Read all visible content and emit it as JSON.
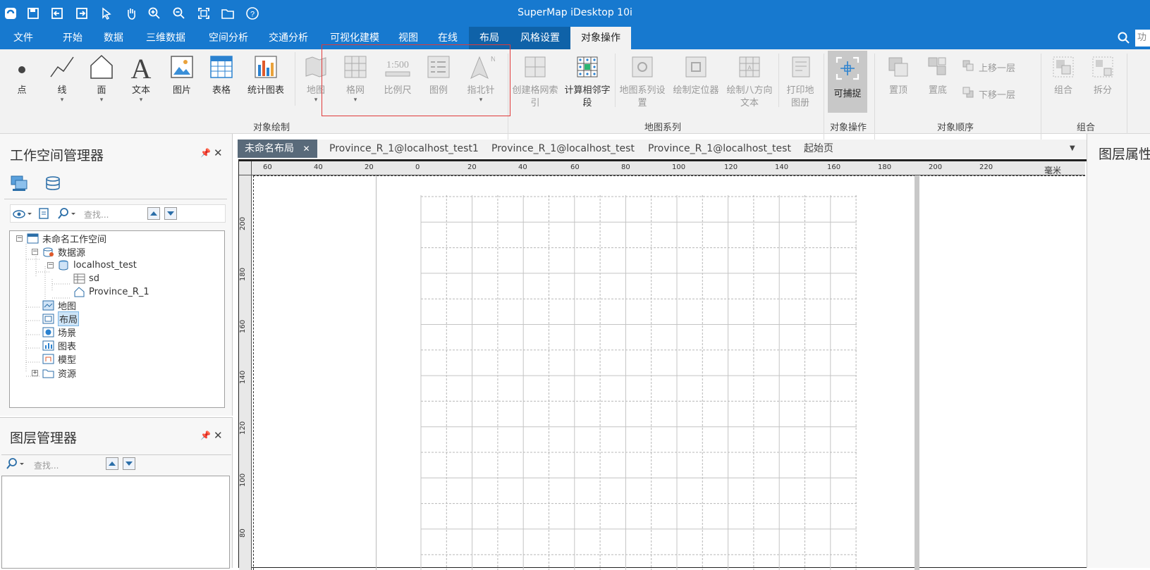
{
  "app": {
    "title": "SuperMap iDesktop 10i"
  },
  "menu": {
    "tabs": [
      "文件",
      "开始",
      "数据",
      "三维数据",
      "空间分析",
      "交通分析",
      "可视化建模",
      "视图",
      "在线",
      "布局",
      "风格设置",
      "对象操作"
    ],
    "search_placeholder": "功"
  },
  "ribbon": {
    "draw_group": {
      "label": "对象绘制",
      "buttons": [
        "点",
        "线",
        "面",
        "文本",
        "图片",
        "表格",
        "统计图表",
        "地图",
        "格网",
        "比例尺",
        "图例",
        "指北针"
      ]
    },
    "series_group": {
      "label": "地图系列",
      "buttons": [
        "创建格网索引",
        "计算相邻字段",
        "地图系列设置",
        "绘制定位器",
        "绘制八方向文本",
        "打印地图册"
      ]
    },
    "capture": {
      "label": "可捕捉",
      "group_label": "对象操作"
    },
    "order_group": {
      "label": "对象顺序",
      "buttons": [
        "置顶",
        "置底",
        "上移一层",
        "下移一层"
      ]
    },
    "combine_group": {
      "label": "组合",
      "buttons": [
        "组合",
        "拆分"
      ]
    },
    "scale_text": "1:500"
  },
  "workspace_manager": {
    "title": "工作空间管理器",
    "search_placeholder": "查找...",
    "tree": {
      "root": "未命名工作空间",
      "datasource": "数据源",
      "db": "localhost_test",
      "ds1": "sd",
      "ds2": "Province_R_1",
      "map": "地图",
      "layout": "布局",
      "scene": "场景",
      "chart": "图表",
      "model": "模型",
      "resources": "资源"
    }
  },
  "layer_manager": {
    "title": "图层管理器",
    "search_placeholder": "查找..."
  },
  "doc_tabs": [
    "未命名布局",
    "Province_R_1@localhost_test1",
    "Province_R_1@localhost_test",
    "Province_R_1@localhost_test",
    "起始页"
  ],
  "layer_props": {
    "title": "图层属性"
  },
  "ruler": {
    "unit": "毫米",
    "h_ticks": [
      "60",
      "40",
      "20",
      "0",
      "20",
      "40",
      "60",
      "80",
      "100",
      "120",
      "140",
      "160",
      "180",
      "200",
      "220"
    ],
    "v_ticks": [
      "200",
      "180",
      "160",
      "140",
      "120",
      "100",
      "80"
    ]
  }
}
